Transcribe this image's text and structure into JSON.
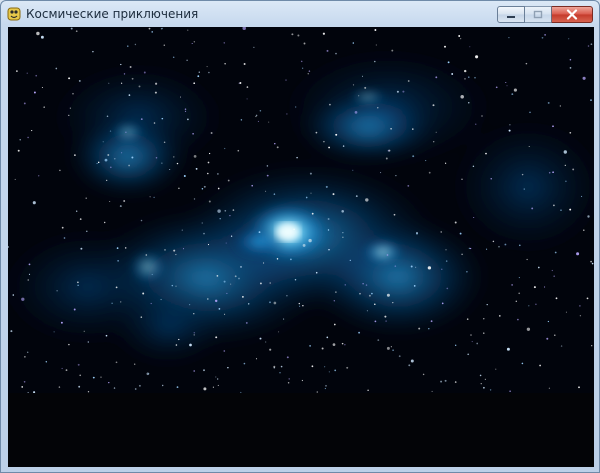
{
  "window": {
    "title": "Космические приключения",
    "app_icon": "python-game-icon"
  },
  "controls": {
    "minimize": "minimize-icon",
    "maximize": "maximize-icon",
    "close": "close-icon"
  },
  "scene": {
    "background": "blue-nebula-starfield",
    "colors": {
      "space": "#000000",
      "nebula": "#1e90d8",
      "nebula_core": "#bff0ff"
    }
  }
}
